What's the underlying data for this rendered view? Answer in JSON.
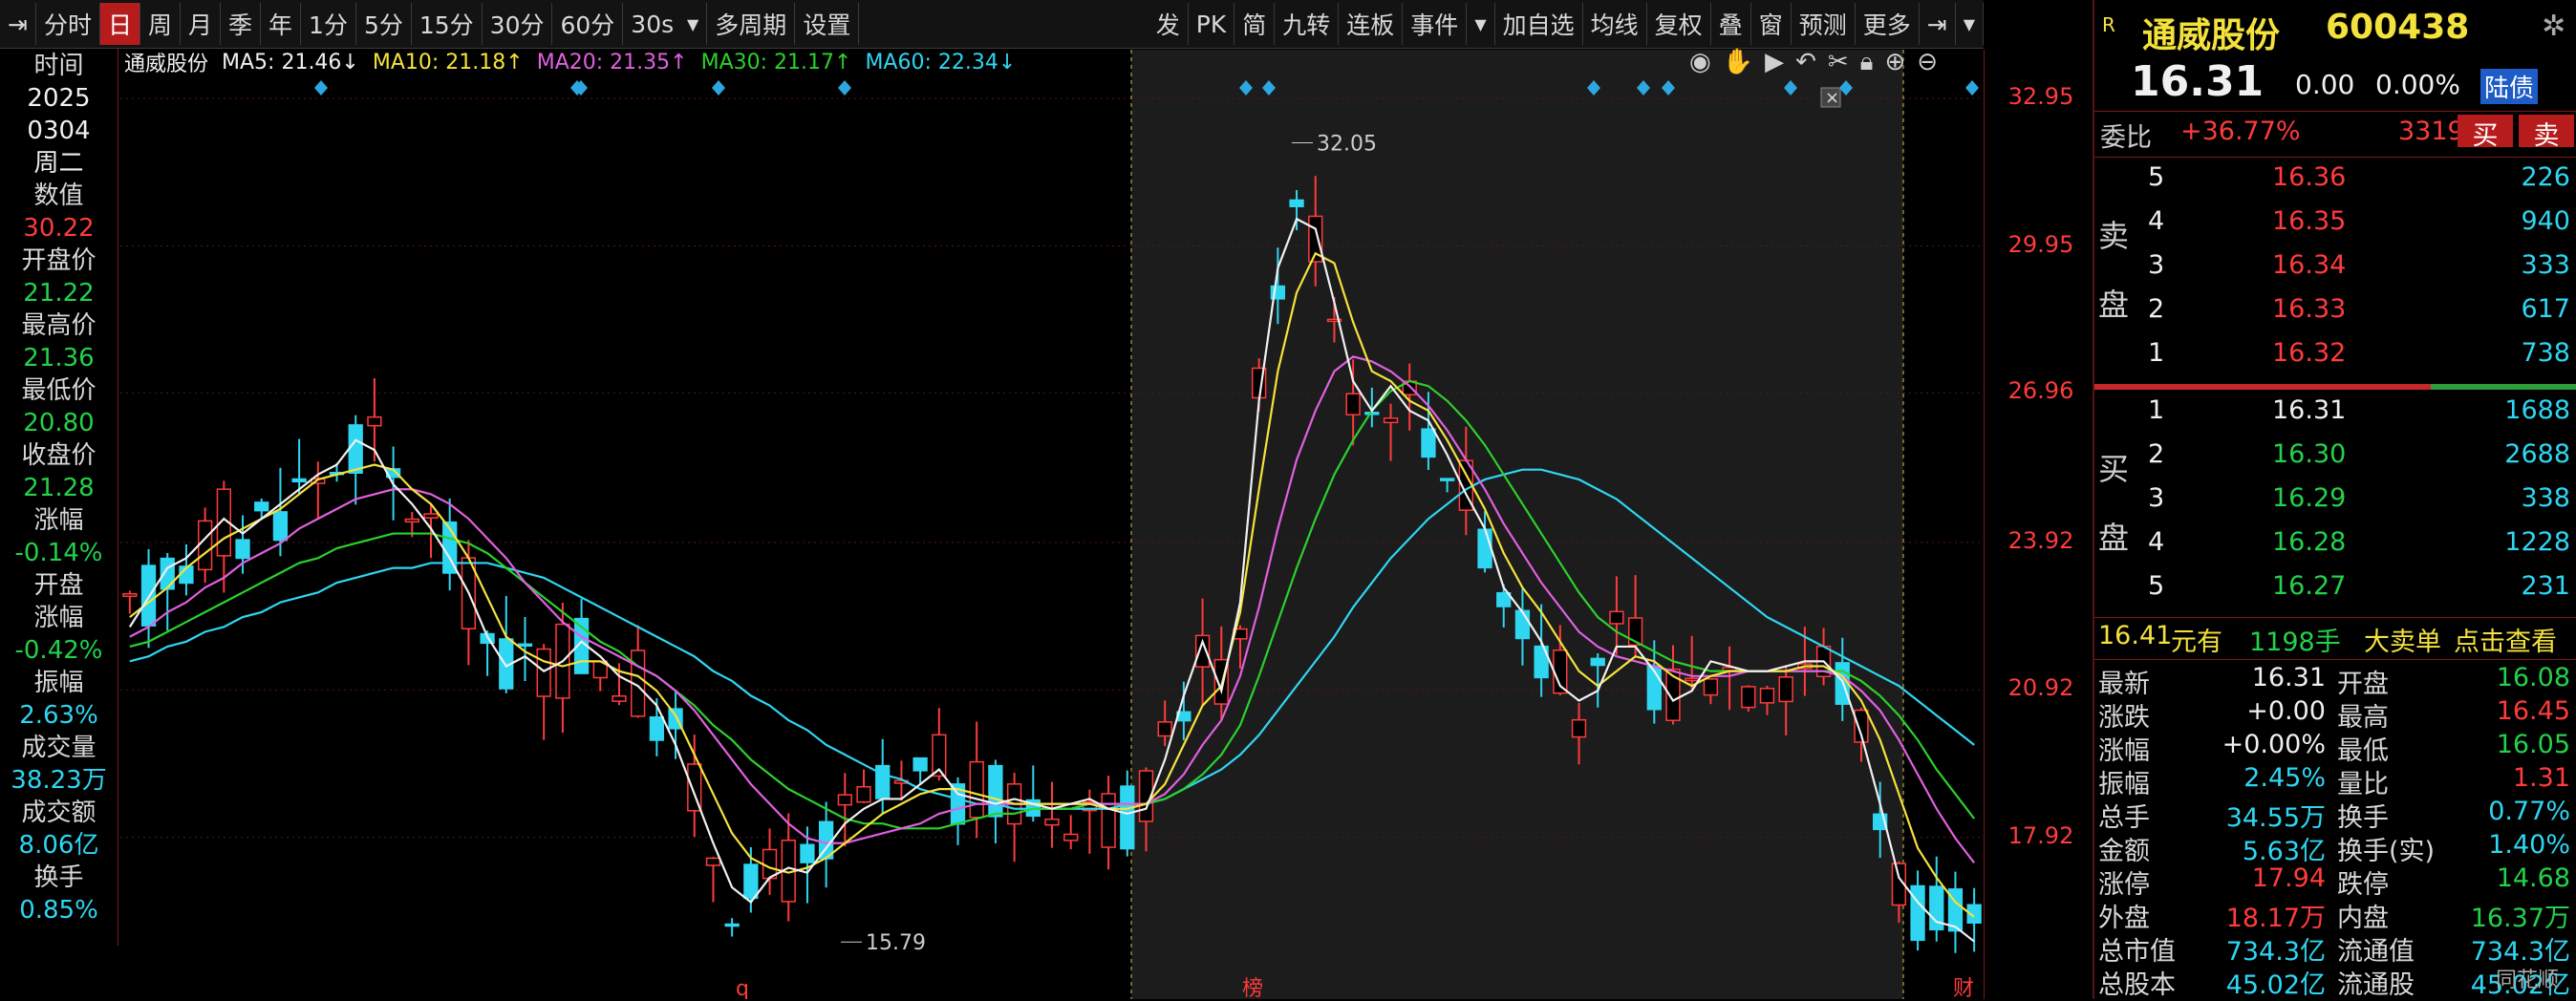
{
  "toolbar": {
    "left_items": [
      "分时",
      "日",
      "周",
      "月",
      "季",
      "年",
      "1分",
      "5分",
      "15分",
      "30分",
      "60分"
    ],
    "active_item": "日",
    "interval_select": "30s",
    "after_select": [
      "多周期",
      "设置"
    ],
    "right_items": [
      "发",
      "PK",
      "简",
      "九转",
      "连板",
      "事件"
    ],
    "right_items2": [
      "加自选",
      "均线",
      "复权",
      "叠",
      "窗",
      "预测",
      "更多"
    ]
  },
  "info_column": {
    "date_label": "时间",
    "year": "2025",
    "monthday": "0304",
    "weekday": "周二",
    "value_label": "数值",
    "value": "30.22",
    "open_label": "开盘价",
    "open": "21.22",
    "high_label": "最高价",
    "high": "21.36",
    "low_label": "最低价",
    "low": "20.80",
    "close_label": "收盘价",
    "close": "21.28",
    "chg_label": "涨幅",
    "chg": "-0.14%",
    "open_chg_label1": "开盘",
    "open_chg_label2": "涨幅",
    "open_chg": "-0.42%",
    "amp_label": "振幅",
    "amp": "2.63%",
    "vol_label": "成交量",
    "vol": "38.23万",
    "amt_label": "成交额",
    "amt": "8.06亿",
    "turn_label": "换手",
    "turn": "0.85%"
  },
  "legend": {
    "stock": "通威股份",
    "ma5": "MA5: 21.46↓",
    "ma10": "MA10: 21.18↑",
    "ma20": "MA20: 21.35↑",
    "ma30": "MA30: 21.17↑",
    "ma60": "MA60: 22.34↓"
  },
  "colors": {
    "up": "#ff3b3b",
    "down": "#23d14a",
    "ma5": "#f0f0f0",
    "ma10": "#f4e23c",
    "ma20": "#e060e0",
    "ma30": "#2bd12b",
    "ma60": "#2ed6f2",
    "accent": "#b71c1c"
  },
  "chart_data": {
    "type": "candlestick",
    "ylim": [
      14.9,
      33.4
    ],
    "yticks": [
      "32.95",
      "29.95",
      "26.96",
      "23.92",
      "20.92",
      "17.92"
    ],
    "annotations": {
      "high_label": "32.05",
      "low_label": "15.79"
    },
    "bottom_markers": [
      "q",
      "榜",
      "财"
    ],
    "ma5_series": [
      22.2,
      22.8,
      23.4,
      23.6,
      24.0,
      24.4,
      24.1,
      24.4,
      24.7,
      25.0,
      25.3,
      25.5,
      26.0,
      25.8,
      25.1,
      24.7,
      24.2,
      23.6,
      22.9,
      22.0,
      21.4,
      21.6,
      21.3,
      21.5,
      21.9,
      21.6,
      21.2,
      21.0,
      20.6,
      19.8,
      18.8,
      17.8,
      16.9,
      16.6,
      17.1,
      17.3,
      17.2,
      17.7,
      18.2,
      18.5,
      18.7,
      18.7,
      19.0,
      19.3,
      18.8,
      18.7,
      18.6,
      18.7,
      18.6,
      18.5,
      18.6,
      18.7,
      18.5,
      18.4,
      18.5,
      19.5,
      20.8,
      21.9,
      20.9,
      22.7,
      26.8,
      29.5,
      30.5,
      30.3,
      28.8,
      27.2,
      26.6,
      27.1,
      26.6,
      26.4,
      25.7,
      24.9,
      24.2,
      23.0,
      22.5,
      21.9,
      21.0,
      20.7,
      20.9,
      21.8,
      21.8,
      21.3,
      20.7,
      20.9,
      21.5,
      21.4,
      21.3,
      21.3,
      21.4,
      21.5,
      21.5,
      21.1,
      20.0,
      18.6,
      17.1,
      16.6,
      16.2,
      16.1,
      15.8
    ],
    "ma10_series": [
      22.4,
      22.7,
      23.0,
      23.4,
      23.7,
      24.0,
      24.2,
      24.4,
      24.6,
      24.9,
      25.2,
      25.3,
      25.4,
      25.5,
      25.4,
      25.0,
      24.7,
      24.2,
      23.6,
      22.8,
      22.0,
      21.7,
      21.5,
      21.4,
      21.5,
      21.5,
      21.3,
      21.2,
      20.9,
      20.4,
      19.6,
      18.8,
      18.0,
      17.5,
      17.3,
      17.2,
      17.3,
      17.5,
      17.8,
      18.1,
      18.4,
      18.6,
      18.8,
      18.9,
      18.9,
      18.8,
      18.7,
      18.6,
      18.6,
      18.6,
      18.6,
      18.6,
      18.5,
      18.5,
      18.6,
      19.0,
      19.8,
      20.6,
      21.0,
      22.5,
      25.0,
      27.4,
      29.0,
      29.8,
      29.6,
      28.4,
      27.4,
      27.2,
      26.8,
      26.6,
      26.0,
      25.3,
      24.6,
      23.7,
      23.0,
      22.5,
      21.9,
      21.3,
      21.0,
      21.3,
      21.6,
      21.5,
      21.2,
      21.0,
      21.2,
      21.3,
      21.3,
      21.3,
      21.3,
      21.4,
      21.4,
      21.2,
      20.7,
      19.9,
      18.8,
      17.7,
      17.1,
      16.6,
      16.3
    ],
    "ma20_series": [
      22.0,
      22.2,
      22.5,
      22.7,
      23.0,
      23.2,
      23.5,
      23.7,
      23.9,
      24.2,
      24.4,
      24.6,
      24.8,
      24.9,
      25.0,
      25.0,
      24.9,
      24.7,
      24.4,
      24.0,
      23.6,
      23.1,
      22.7,
      22.3,
      22.0,
      21.8,
      21.6,
      21.4,
      21.2,
      20.9,
      20.5,
      20.0,
      19.5,
      19.0,
      18.6,
      18.2,
      17.9,
      17.8,
      17.8,
      17.9,
      18.0,
      18.1,
      18.2,
      18.4,
      18.5,
      18.6,
      18.6,
      18.6,
      18.6,
      18.6,
      18.6,
      18.6,
      18.6,
      18.6,
      18.6,
      18.8,
      19.2,
      19.8,
      20.3,
      21.2,
      22.6,
      24.2,
      25.6,
      26.6,
      27.4,
      27.7,
      27.6,
      27.4,
      27.1,
      26.7,
      26.2,
      25.6,
      25.0,
      24.3,
      23.7,
      23.1,
      22.6,
      22.1,
      21.8,
      21.6,
      21.5,
      21.4,
      21.3,
      21.2,
      21.2,
      21.2,
      21.3,
      21.3,
      21.3,
      21.3,
      21.3,
      21.2,
      20.9,
      20.5,
      19.9,
      19.2,
      18.5,
      17.9,
      17.4
    ],
    "ma30_series": [
      21.8,
      21.9,
      22.1,
      22.3,
      22.5,
      22.7,
      22.9,
      23.1,
      23.3,
      23.5,
      23.6,
      23.8,
      23.9,
      24.0,
      24.1,
      24.1,
      24.1,
      24.0,
      23.9,
      23.7,
      23.4,
      23.1,
      22.8,
      22.5,
      22.2,
      21.9,
      21.7,
      21.4,
      21.2,
      20.9,
      20.6,
      20.2,
      19.9,
      19.5,
      19.2,
      18.9,
      18.7,
      18.5,
      18.3,
      18.2,
      18.2,
      18.1,
      18.1,
      18.1,
      18.2,
      18.3,
      18.4,
      18.4,
      18.5,
      18.5,
      18.5,
      18.6,
      18.6,
      18.6,
      18.6,
      18.7,
      18.9,
      19.2,
      19.6,
      20.2,
      21.2,
      22.3,
      23.4,
      24.4,
      25.3,
      26.0,
      26.6,
      27.0,
      27.2,
      27.1,
      26.8,
      26.4,
      25.9,
      25.3,
      24.7,
      24.1,
      23.5,
      22.9,
      22.4,
      22.1,
      21.9,
      21.7,
      21.5,
      21.4,
      21.3,
      21.3,
      21.3,
      21.3,
      21.3,
      21.3,
      21.3,
      21.3,
      21.1,
      20.8,
      20.4,
      19.9,
      19.3,
      18.8,
      18.3
    ],
    "ma60_series": [
      21.5,
      21.6,
      21.8,
      21.9,
      22.1,
      22.2,
      22.4,
      22.5,
      22.7,
      22.8,
      22.9,
      23.1,
      23.2,
      23.3,
      23.4,
      23.4,
      23.5,
      23.5,
      23.5,
      23.5,
      23.4,
      23.3,
      23.2,
      23.0,
      22.8,
      22.6,
      22.4,
      22.2,
      22.0,
      21.8,
      21.6,
      21.3,
      21.1,
      20.8,
      20.6,
      20.3,
      20.1,
      19.8,
      19.6,
      19.4,
      19.2,
      19.1,
      18.9,
      18.8,
      18.7,
      18.6,
      18.6,
      18.5,
      18.5,
      18.5,
      18.5,
      18.5,
      18.5,
      18.6,
      18.6,
      18.7,
      18.9,
      19.1,
      19.3,
      19.6,
      20.0,
      20.5,
      21.0,
      21.5,
      22.0,
      22.6,
      23.1,
      23.6,
      24.0,
      24.4,
      24.7,
      25.0,
      25.2,
      25.3,
      25.4,
      25.4,
      25.3,
      25.2,
      25.0,
      24.8,
      24.5,
      24.2,
      23.9,
      23.6,
      23.3,
      23.0,
      22.7,
      22.4,
      22.2,
      22.0,
      21.8,
      21.6,
      21.4,
      21.2,
      21.0,
      20.7,
      20.4,
      20.1,
      19.8
    ]
  },
  "quote": {
    "name": "通威股份",
    "code": "600438",
    "price": "16.31",
    "change": "0.00",
    "change_pct": "0.00%",
    "tag": "陆债",
    "weibi_label": "委比",
    "weibi": "+36.77%",
    "weicha": "3319",
    "buy_btn": "买",
    "sell_btn": "卖",
    "sell_label": [
      "卖",
      "盘"
    ],
    "buy_label": [
      "买",
      "盘"
    ],
    "asks": [
      {
        "level": "5",
        "price": "16.36",
        "vol": "226"
      },
      {
        "level": "4",
        "price": "16.35",
        "vol": "940"
      },
      {
        "level": "3",
        "price": "16.34",
        "vol": "333"
      },
      {
        "level": "2",
        "price": "16.33",
        "vol": "617"
      },
      {
        "level": "1",
        "price": "16.32",
        "vol": "738"
      }
    ],
    "bids": [
      {
        "level": "1",
        "price": "16.31",
        "vol": "1688"
      },
      {
        "level": "2",
        "price": "16.30",
        "vol": "2688"
      },
      {
        "level": "3",
        "price": "16.29",
        "vol": "338"
      },
      {
        "level": "4",
        "price": "16.28",
        "vol": "1228"
      },
      {
        "level": "5",
        "price": "16.27",
        "vol": "231"
      }
    ],
    "bigorder": {
      "price": "16.41",
      "unit": "元有",
      "vol": "1198手",
      "label": "大卖单",
      "link": "点击查看"
    },
    "stats": [
      {
        "l1": "最新",
        "v1": "16.31",
        "c1": "white",
        "l2": "开盘",
        "v2": "16.08",
        "c2": "green"
      },
      {
        "l1": "涨跌",
        "v1": "+0.00",
        "c1": "white",
        "l2": "最高",
        "v2": "16.45",
        "c2": "red"
      },
      {
        "l1": "涨幅",
        "v1": "+0.00%",
        "c1": "white",
        "l2": "最低",
        "v2": "16.05",
        "c2": "green"
      },
      {
        "l1": "振幅",
        "v1": "2.45%",
        "c1": "cyan",
        "l2": "量比",
        "v2": "1.31",
        "c2": "red"
      },
      {
        "l1": "总手",
        "v1": "34.55万",
        "c1": "cyan",
        "l2": "换手",
        "v2": "0.77%",
        "c2": "cyan"
      },
      {
        "l1": "金额",
        "v1": "5.63亿",
        "c1": "cyan",
        "l2": "换手(实)",
        "v2": "1.40%",
        "c2": "cyan"
      },
      {
        "l1": "涨停",
        "v1": "17.94",
        "c1": "red",
        "l2": "跌停",
        "v2": "14.68",
        "c2": "green"
      },
      {
        "l1": "外盘",
        "v1": "18.17万",
        "c1": "red",
        "l2": "内盘",
        "v2": "16.37万",
        "c2": "green"
      },
      {
        "l1": "总市值",
        "v1": "734.3亿",
        "c1": "cyan",
        "l2": "流通值",
        "v2": "734.3亿",
        "c2": "cyan"
      },
      {
        "l1": "总股本",
        "v1": "45.02亿",
        "c1": "cyan",
        "l2": "流通股",
        "v2": "45.02亿",
        "c2": "cyan"
      }
    ],
    "watermark": "同花顺"
  }
}
